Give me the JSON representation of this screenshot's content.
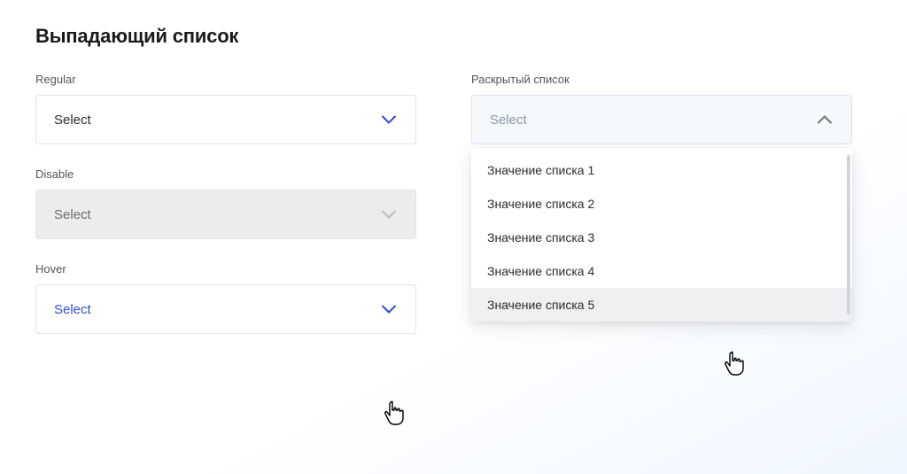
{
  "title": "Выпадающий список",
  "left": {
    "regular": {
      "label": "Regular",
      "placeholder": "Select"
    },
    "disable": {
      "label": "Disable",
      "placeholder": "Select"
    },
    "hover": {
      "label": "Hover",
      "placeholder": "Select"
    }
  },
  "right": {
    "open": {
      "label": "Раскрытый список",
      "placeholder": "Select",
      "options": [
        "Значение списка 1",
        "Значение списка 2",
        "Значение списка 3",
        "Значение списка 4",
        "Значение списка 5"
      ]
    }
  }
}
